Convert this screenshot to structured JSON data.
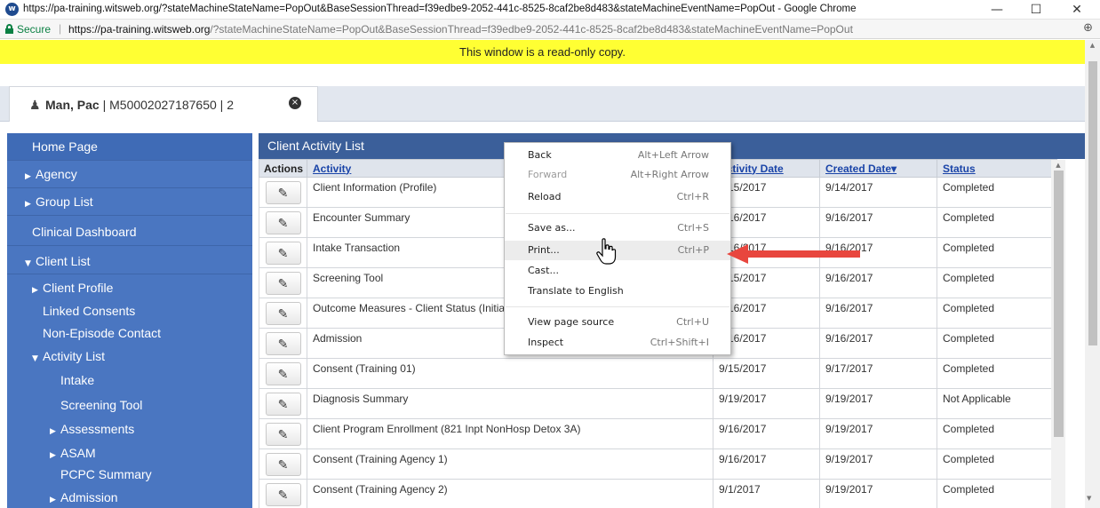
{
  "browser": {
    "window_title": "https://pa-training.witsweb.org/?stateMachineStateName=PopOut&BaseSessionThread=f39edbe9-2052-441c-8525-8caf2be8d483&stateMachineEventName=PopOut - Google Chrome",
    "app_icon_letter": "w",
    "secure_label": "Secure",
    "separator": "|",
    "url_host": "https://pa-training.witsweb.org",
    "url_path": "/?stateMachineStateName=PopOut&BaseSessionThread=f39edbe9-2052-441c-8525-8caf2be8d483&stateMachineEventName=PopOut",
    "minimize": "—",
    "maximize": "☐",
    "close": "✕",
    "zoom_icon": "⊕"
  },
  "banner": "This window is a read-only copy.",
  "tab": {
    "name": "Man, Pac",
    "rest": " | M50002027187650 | 2",
    "close_glyph": "×"
  },
  "sidebar": {
    "items": [
      {
        "label": "Home Page",
        "arrow": ""
      },
      {
        "label": "Agency",
        "arrow": "▶"
      },
      {
        "label": "Group List",
        "arrow": "▶"
      },
      {
        "label": "Clinical Dashboard",
        "arrow": ""
      },
      {
        "label": "Client List",
        "arrow": "▼"
      }
    ],
    "sub_items": [
      {
        "label": "Client Profile",
        "arrow": "▶"
      },
      {
        "label": "Linked Consents",
        "arrow": ""
      },
      {
        "label": "Non-Episode Contact",
        "arrow": ""
      },
      {
        "label": "Activity List",
        "arrow": "▼"
      },
      {
        "label": "Intake",
        "arrow": ""
      },
      {
        "label": "Screening Tool",
        "arrow": ""
      },
      {
        "label": "Assessments",
        "arrow": "▶"
      },
      {
        "label": "ASAM",
        "arrow": "▶"
      },
      {
        "label": "PCPC Summary",
        "arrow": ""
      },
      {
        "label": "Admission",
        "arrow": "▶"
      }
    ]
  },
  "panel": {
    "title": "Client Activity List",
    "columns": [
      "Actions",
      "Activity",
      "Activity Date",
      "Created Date▾",
      "Status"
    ],
    "rows": [
      {
        "activity": "Client Information (Profile)",
        "activity_date": "9/15/2017",
        "created": "9/14/2017",
        "status": "Completed"
      },
      {
        "activity": "Encounter Summary",
        "activity_date": "9/16/2017",
        "created": "9/16/2017",
        "status": "Completed"
      },
      {
        "activity": "Intake Transaction",
        "activity_date": "9/16/2017",
        "created": "9/16/2017",
        "status": "Completed"
      },
      {
        "activity": "Screening Tool",
        "activity_date": "9/15/2017",
        "created": "9/16/2017",
        "status": "Completed"
      },
      {
        "activity": "Outcome Measures - Client Status (Initial)",
        "activity_date": "9/16/2017",
        "created": "9/16/2017",
        "status": "Completed"
      },
      {
        "activity": "Admission",
        "activity_date": "9/16/2017",
        "created": "9/16/2017",
        "status": "Completed"
      },
      {
        "activity": "Consent (Training 01)",
        "activity_date": "9/15/2017",
        "created": "9/17/2017",
        "status": "Completed"
      },
      {
        "activity": "Diagnosis Summary",
        "activity_date": "9/19/2017",
        "created": "9/19/2017",
        "status": "Not Applicable"
      },
      {
        "activity": "Client Program Enrollment (821 Inpt NonHosp Detox 3A)",
        "activity_date": "9/16/2017",
        "created": "9/19/2017",
        "status": "Completed"
      },
      {
        "activity": "Consent (Training Agency 1)",
        "activity_date": "9/16/2017",
        "created": "9/19/2017",
        "status": "Completed"
      },
      {
        "activity": "Consent (Training Agency 2)",
        "activity_date": "9/1/2017",
        "created": "9/19/2017",
        "status": "Completed"
      }
    ]
  },
  "context_menu": {
    "items": [
      {
        "label": "Back",
        "shortcut": "Alt+Left Arrow"
      },
      {
        "label": "Forward",
        "shortcut": "Alt+Right Arrow"
      },
      {
        "label": "Reload",
        "shortcut": "Ctrl+R"
      },
      {
        "label": "Save as...",
        "shortcut": "Ctrl+S"
      },
      {
        "label": "Print...",
        "shortcut": "Ctrl+P"
      },
      {
        "label": "Cast...",
        "shortcut": ""
      },
      {
        "label": "Translate to English",
        "shortcut": ""
      },
      {
        "label": "View page source",
        "shortcut": "Ctrl+U"
      },
      {
        "label": "Inspect",
        "shortcut": "Ctrl+Shift+I"
      }
    ]
  },
  "colors": {
    "sidebar": "#4a76c1",
    "panel_header": "#3b5f9a",
    "banner": "#ffff33",
    "arrow": "#e8463e",
    "link": "#1a44a8"
  },
  "icons": {
    "edit": "pencil-icon",
    "cursor": "hand-pointer-icon",
    "callout": "red-arrow-icon"
  }
}
